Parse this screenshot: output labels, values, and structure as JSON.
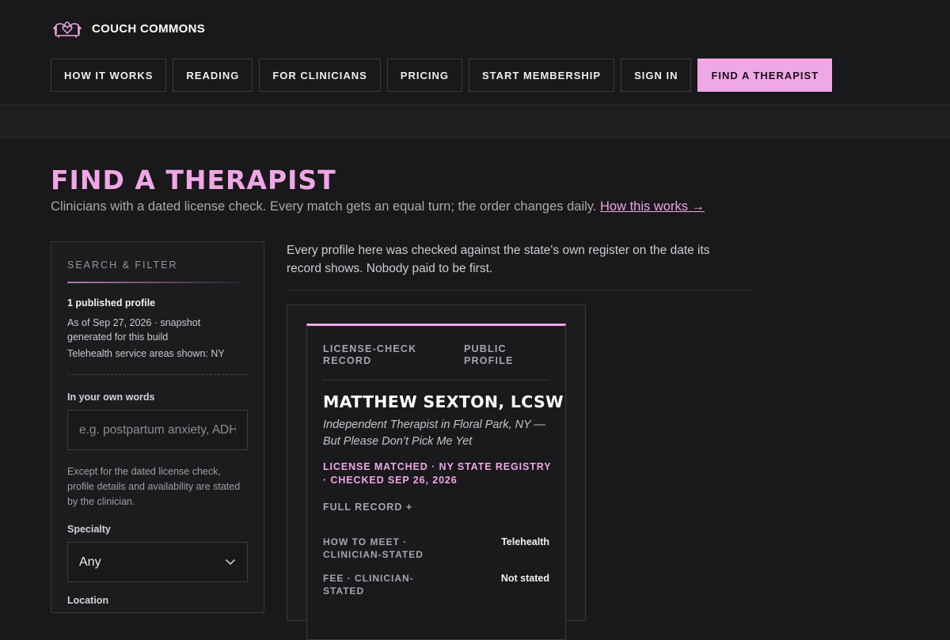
{
  "brand": {
    "name": "COUCH COMMONS",
    "logo_icon": "couch-heart-icon"
  },
  "nav": [
    {
      "label": "HOW IT WORKS"
    },
    {
      "label": "READING"
    },
    {
      "label": "FOR CLINICIANS"
    },
    {
      "label": "PRICING"
    },
    {
      "label": "START MEMBERSHIP"
    },
    {
      "label": "SIGN IN"
    },
    {
      "label": "FIND A THERAPIST",
      "primary": true
    }
  ],
  "page": {
    "title": "FIND A THERAPIST",
    "subtitle": "Clinicians with a dated license check. Every match gets an equal turn; the order changes daily.",
    "subtitle_link": "How this works →"
  },
  "filter": {
    "heading": "SEARCH & FILTER",
    "count": "1 published profile",
    "as_of": "As of Sep 27, 2026 · snapshot generated for this build",
    "telehealth": "Telehealth service areas shown: NY",
    "own_words_label": "In your own words",
    "own_words_placeholder": "e.g. postpartum anxiety, ADHD",
    "note": "Except for the dated license check, profile details and availability are stated by the clinician.",
    "specialty_label": "Specialty",
    "specialty_value": "Any",
    "location_label": "Location"
  },
  "intro": "Every profile here was checked against the state's own register on the date its record shows. Nobody paid to be first.",
  "profile": {
    "tab_record": "LICENSE-CHECK RECORD",
    "tab_public": "PUBLIC PROFILE",
    "name": "MATTHEW SEXTON, LCSW",
    "description": "Independent Therapist in Floral Park, NY — But Please Don’t Pick Me Yet",
    "license": "LICENSE MATCHED · NY STATE REGISTRY · CHECKED SEP 26, 2026",
    "full_record": "FULL RECORD +",
    "fields": [
      {
        "key": "HOW TO MEET · CLINICIAN-STATED",
        "value": "Telehealth"
      },
      {
        "key": "FEE · CLINICIAN-STATED",
        "value": "Not stated"
      }
    ]
  },
  "colors": {
    "accent": "#f0a7e6",
    "background": "#19181a"
  }
}
